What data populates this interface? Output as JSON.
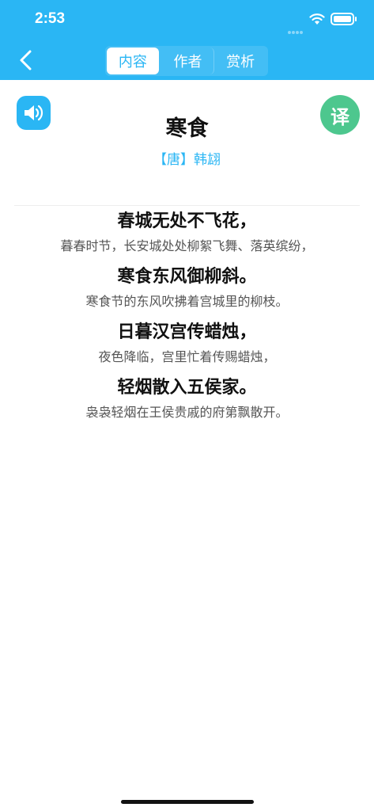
{
  "status_bar": {
    "time": "2:53"
  },
  "header": {
    "tabs": [
      {
        "label": "内容",
        "active": true
      },
      {
        "label": "作者",
        "active": false
      },
      {
        "label": "赏析",
        "active": false
      }
    ]
  },
  "poem": {
    "title": "寒食",
    "author": "【唐】韩翃",
    "translate_label": "译",
    "lines": [
      {
        "original": "春城无处不飞花，",
        "translation": "暮春时节，长安城处处柳絮飞舞、落英缤纷，"
      },
      {
        "original": "寒食东风御柳斜。",
        "translation": "寒食节的东风吹拂着宫城里的柳枝。"
      },
      {
        "original": "日暮汉宫传蜡烛，",
        "translation": "夜色降临，宫里忙着传赐蜡烛，"
      },
      {
        "original": "轻烟散入五侯家。",
        "translation": "袅袅轻烟在王侯贵戚的府第飘散开。"
      }
    ]
  },
  "colors": {
    "header_bg": "#2ab6f4",
    "translate_bg": "#4dc78e",
    "accent": "#2ab6f4"
  }
}
